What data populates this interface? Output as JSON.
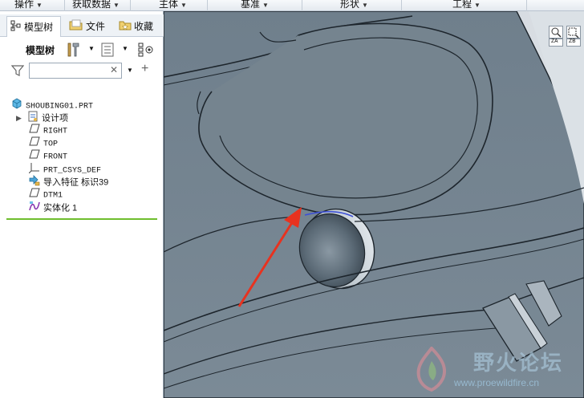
{
  "menu": {
    "items": [
      {
        "label": "操作"
      },
      {
        "label": "获取数据"
      },
      {
        "label": "主体"
      },
      {
        "label": "基准"
      },
      {
        "label": "形状"
      },
      {
        "label": "工程"
      }
    ]
  },
  "tabs": [
    {
      "label": "模型树"
    },
    {
      "label": "文件"
    },
    {
      "label": "收藏"
    }
  ],
  "toolbar": {
    "label": "模型树"
  },
  "search": {
    "value": "",
    "placeholder": ""
  },
  "tree": {
    "root": "SHOUBING01.PRT",
    "items": [
      {
        "label": "设计项",
        "icon": "design-items-icon"
      },
      {
        "label": "RIGHT",
        "icon": "datum-plane-icon"
      },
      {
        "label": "TOP",
        "icon": "datum-plane-icon"
      },
      {
        "label": "FRONT",
        "icon": "datum-plane-icon"
      },
      {
        "label": "PRT_CSYS_DEF",
        "icon": "coordinate-system-icon"
      },
      {
        "label": "导入特征 标识39",
        "icon": "import-feature-icon"
      },
      {
        "label": "DTM1",
        "icon": "datum-plane-icon"
      },
      {
        "label": "实体化 1",
        "icon": "solidify-icon"
      }
    ]
  },
  "viewport": {
    "controls": [
      "zoom-area-icon",
      "zoom-box-icon"
    ],
    "control_labels": [
      "ZA",
      "ZB"
    ]
  },
  "watermark": {
    "title": "野火论坛",
    "url": "www.proewildfire.cn"
  },
  "colors": {
    "model_fill": "#71818e",
    "model_edge": "#1d252c",
    "annotation_arrow": "#e8321f",
    "tree_divider": "#6fbe2e",
    "selection_blue": "#3d50d6"
  }
}
